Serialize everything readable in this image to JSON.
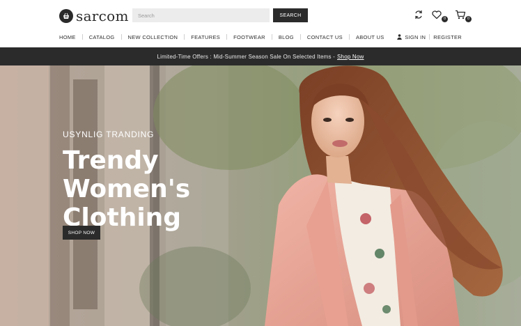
{
  "brand": {
    "name": "sarcom",
    "icon": "basket-icon"
  },
  "search": {
    "placeholder": "Search",
    "button_label": "SEARCH"
  },
  "header_icons": {
    "compare": {
      "icon": "compare-icon"
    },
    "wishlist": {
      "icon": "heart-icon",
      "count": "0"
    },
    "cart": {
      "icon": "cart-icon",
      "count": "0"
    }
  },
  "nav": {
    "items": [
      {
        "label": "HOME"
      },
      {
        "label": "CATALOG"
      },
      {
        "label": "NEW COLLECTION"
      },
      {
        "label": "FEATURES"
      },
      {
        "label": "FOOTWEAR"
      },
      {
        "label": "BLOG"
      },
      {
        "label": "CONTACT US"
      },
      {
        "label": "ABOUT US"
      }
    ]
  },
  "account": {
    "sign_in": "SIGN IN",
    "register": "REGISTER",
    "icon": "user-icon"
  },
  "promo": {
    "text": "Limited-Time Offers : Mid-Summer Season Sale On Selected Items -",
    "link": "Shop Now"
  },
  "hero": {
    "kicker": "USYNLIG TRANDING",
    "headline": "Trendy Women's Clothing",
    "button_label": "SHOP NOW"
  },
  "colors": {
    "dark": "#2b2b2b",
    "coat": "#e9a79a",
    "hair": "#8a4a2e"
  }
}
